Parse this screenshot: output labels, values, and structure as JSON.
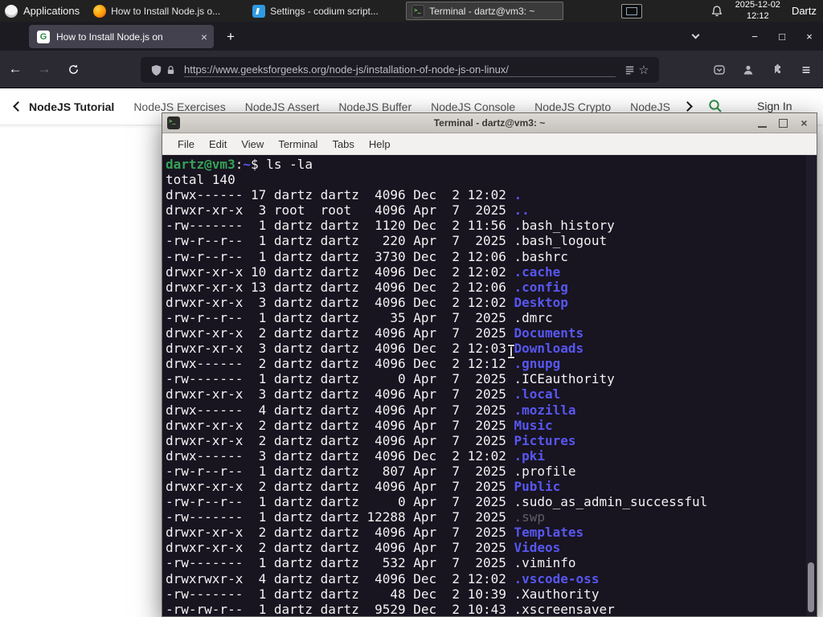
{
  "colors": {
    "gfg_green": "#2f8d46",
    "terminal_bg": "#181420",
    "dir_blue": "#5757f0",
    "prompt_green": "#33a357",
    "firefox_toolbar": "#2b2a33",
    "panel_bg": "#212121"
  },
  "icons": {
    "plus": "+",
    "close": "×",
    "minimize": "−",
    "maximize": "□",
    "back": "←",
    "forward": "→",
    "menu": "≡",
    "star": "☆",
    "favicon_letter": "G"
  },
  "panel": {
    "applications_label": "Applications",
    "windows": [
      {
        "title": "How to Install Node.js o...",
        "icon": "firefox",
        "state": "normal"
      },
      {
        "title": "Settings - codium script...",
        "icon": "codium",
        "state": "normal"
      },
      {
        "title": "Terminal - dartz@vm3: ~",
        "icon": "terminal",
        "state": "active"
      }
    ],
    "clock": {
      "date": "2025-12-02",
      "time": "12:12"
    },
    "user": "Dartz"
  },
  "browser": {
    "tab_title": "How to Install Node.js on",
    "url": "https://www.geeksforgeeks.org/node-js/installation-of-node-js-on-linux/",
    "nav_items": [
      {
        "label": "NodeJS Tutorial",
        "style": "active"
      },
      {
        "label": "NodeJS Exercises",
        "style": "normal"
      },
      {
        "label": "NodeJS Assert",
        "style": "normal"
      },
      {
        "label": "NodeJS Buffer",
        "style": "normal"
      },
      {
        "label": "NodeJS Console",
        "style": "normal"
      },
      {
        "label": "NodeJS Crypto",
        "style": "normal"
      },
      {
        "label": "NodeJS DNS",
        "style": "normal"
      },
      {
        "label": "Node",
        "style": "normal"
      }
    ],
    "sign_in_label": "Sign In"
  },
  "terminal": {
    "title": "Terminal - dartz@vm3: ~",
    "menu": [
      "File",
      "Edit",
      "View",
      "Terminal",
      "Tabs",
      "Help"
    ],
    "prompt": {
      "user_host": "dartz@vm3",
      "colon": ":",
      "path": "~",
      "dollar": "$",
      "command": " ls -la"
    },
    "total_line": "total 140",
    "listing": [
      {
        "pre": "drwx------ 17 dartz dartz  4096 Dec  2 12:02 ",
        "file": ".",
        "type": "dir"
      },
      {
        "pre": "drwxr-xr-x  3 root  root   4096 Apr  7  2025 ",
        "file": "..",
        "type": "dir"
      },
      {
        "pre": "-rw-------  1 dartz dartz  1120 Dec  2 11:56 ",
        "file": ".bash_history",
        "type": "plain"
      },
      {
        "pre": "-rw-r--r--  1 dartz dartz   220 Apr  7  2025 ",
        "file": ".bash_logout",
        "type": "plain"
      },
      {
        "pre": "-rw-r--r--  1 dartz dartz  3730 Dec  2 12:06 ",
        "file": ".bashrc",
        "type": "plain"
      },
      {
        "pre": "drwxr-xr-x 10 dartz dartz  4096 Dec  2 12:02 ",
        "file": ".cache",
        "type": "dir"
      },
      {
        "pre": "drwxr-xr-x 13 dartz dartz  4096 Dec  2 12:06 ",
        "file": ".config",
        "type": "dir"
      },
      {
        "pre": "drwxr-xr-x  3 dartz dartz  4096 Dec  2 12:02 ",
        "file": "Desktop",
        "type": "dir"
      },
      {
        "pre": "-rw-r--r--  1 dartz dartz    35 Apr  7  2025 ",
        "file": ".dmrc",
        "type": "plain"
      },
      {
        "pre": "drwxr-xr-x  2 dartz dartz  4096 Apr  7  2025 ",
        "file": "Documents",
        "type": "dir"
      },
      {
        "pre": "drwxr-xr-x  3 dartz dartz  4096 Dec  2 12:03 ",
        "file": "Downloads",
        "type": "dir"
      },
      {
        "pre": "drwx------  2 dartz dartz  4096 Dec  2 12:12 ",
        "file": ".gnupg",
        "type": "dir"
      },
      {
        "pre": "-rw-------  1 dartz dartz     0 Apr  7  2025 ",
        "file": ".ICEauthority",
        "type": "plain"
      },
      {
        "pre": "drwxr-xr-x  3 dartz dartz  4096 Apr  7  2025 ",
        "file": ".local",
        "type": "dir"
      },
      {
        "pre": "drwx------  4 dartz dartz  4096 Apr  7  2025 ",
        "file": ".mozilla",
        "type": "dir"
      },
      {
        "pre": "drwxr-xr-x  2 dartz dartz  4096 Apr  7  2025 ",
        "file": "Music",
        "type": "dir"
      },
      {
        "pre": "drwxr-xr-x  2 dartz dartz  4096 Apr  7  2025 ",
        "file": "Pictures",
        "type": "dir"
      },
      {
        "pre": "drwx------  3 dartz dartz  4096 Dec  2 12:02 ",
        "file": ".pki",
        "type": "dir"
      },
      {
        "pre": "-rw-r--r--  1 dartz dartz   807 Apr  7  2025 ",
        "file": ".profile",
        "type": "plain"
      },
      {
        "pre": "drwxr-xr-x  2 dartz dartz  4096 Apr  7  2025 ",
        "file": "Public",
        "type": "dir"
      },
      {
        "pre": "-rw-r--r--  1 dartz dartz     0 Apr  7  2025 ",
        "file": ".sudo_as_admin_successful",
        "type": "plain"
      },
      {
        "pre": "-rw-------  1 dartz dartz 12288 Apr  7  2025 ",
        "file": ".swp",
        "type": "dim"
      },
      {
        "pre": "drwxr-xr-x  2 dartz dartz  4096 Apr  7  2025 ",
        "file": "Templates",
        "type": "dir"
      },
      {
        "pre": "drwxr-xr-x  2 dartz dartz  4096 Apr  7  2025 ",
        "file": "Videos",
        "type": "dir"
      },
      {
        "pre": "-rw-------  1 dartz dartz   532 Apr  7  2025 ",
        "file": ".viminfo",
        "type": "plain"
      },
      {
        "pre": "drwxrwxr-x  4 dartz dartz  4096 Dec  2 12:02 ",
        "file": ".vscode-oss",
        "type": "dir"
      },
      {
        "pre": "-rw-------  1 dartz dartz    48 Dec  2 10:39 ",
        "file": ".Xauthority",
        "type": "plain"
      },
      {
        "pre": "-rw-rw-r--  1 dartz dartz  9529 Dec  2 10:43 ",
        "file": ".xscreensaver",
        "type": "plain"
      }
    ]
  }
}
